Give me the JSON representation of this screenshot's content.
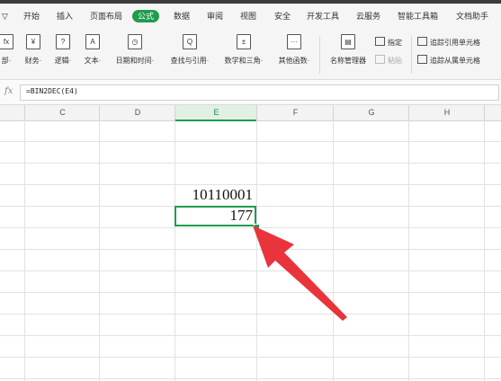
{
  "ribbon_tabs": [
    "▽",
    "开始",
    "插入",
    "页面布局",
    "公式",
    "数据",
    "审阅",
    "视图",
    "安全",
    "开发工具",
    "云服务",
    "智能工具箱",
    "文档助手"
  ],
  "active_tab": "公式",
  "ribbon": {
    "buttons": [
      {
        "icon": "fx",
        "label": "部·"
      },
      {
        "icon": "¥",
        "label": "财务·"
      },
      {
        "icon": "?",
        "label": "逻辑·"
      },
      {
        "icon": "A",
        "label": "文本·"
      },
      {
        "icon": "◷",
        "label": "日期和时间·"
      },
      {
        "icon": "Q",
        "label": "查找与引用·"
      },
      {
        "icon": "±",
        "label": "数学和三角·"
      },
      {
        "icon": "···",
        "label": "其他函数·"
      },
      {
        "icon": "▤",
        "label": "名称管理器"
      }
    ],
    "small": {
      "specify": "指定",
      "paste": "粘贴",
      "trace_precedents": "追踪引用单元格",
      "trace_dependents": "追踪从属单元格"
    }
  },
  "formula_bar": {
    "fx_label": "fx",
    "formula": "=BIN2DEC(E4)"
  },
  "columns": [
    "C",
    "D",
    "E",
    "F",
    "G",
    "H"
  ],
  "selected_column": "E",
  "cells": {
    "e3": "10110001",
    "e4": "177"
  },
  "colors": {
    "accent": "#1f9c4d",
    "arrow": "#e8343a"
  }
}
